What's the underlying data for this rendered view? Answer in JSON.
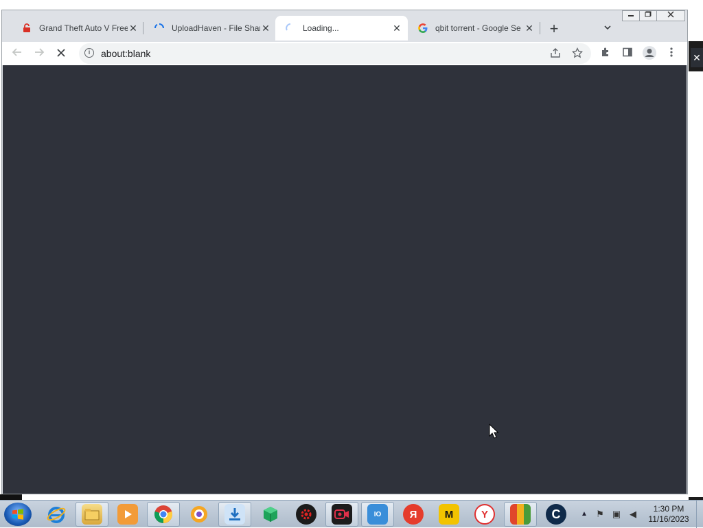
{
  "browser": {
    "tabs": [
      {
        "title": "Grand Theft Auto V Free",
        "favicon": "lock-red-icon",
        "active": false
      },
      {
        "title": "UploadHaven - File Shar",
        "favicon": "loading-spinner-icon",
        "active": false
      },
      {
        "title": "Loading...",
        "favicon": "loading-spinner-icon",
        "active": true
      },
      {
        "title": "qbit torrent - Google Se",
        "favicon": "google-icon",
        "active": false
      }
    ],
    "close_glyph": "✕",
    "new_tab_glyph": "+",
    "address": {
      "url": "about:blank"
    },
    "page_background": "#2f323b"
  },
  "desktop": {
    "close_glyph": "✕"
  },
  "taskbar": {
    "apps": [
      {
        "name": "internet-explorer-icon",
        "color": "#1e7fd8"
      },
      {
        "name": "file-explorer-icon",
        "color": "#e8c25a"
      },
      {
        "name": "media-player-icon",
        "color": "#f29b38"
      },
      {
        "name": "chrome-icon",
        "color": "#db4437"
      },
      {
        "name": "browser-circle-icon",
        "color": "#f5a623"
      },
      {
        "name": "downloader-icon",
        "color": "#3b89d6"
      },
      {
        "name": "cube-app-icon",
        "color": "#1ea35a"
      },
      {
        "name": "gear-red-icon",
        "color": "#c41c1c"
      },
      {
        "name": "screen-recorder-icon",
        "color": "#c0203a"
      },
      {
        "name": "iobit-icon",
        "color": "#3a8ed9"
      },
      {
        "name": "yandex-icon",
        "color": "#e53c2c"
      },
      {
        "name": "yellow-m-icon",
        "color": "#f2c300"
      },
      {
        "name": "yandex-browser-icon",
        "color": "#e03030"
      },
      {
        "name": "avg-icon",
        "color": "#4a9b3a"
      },
      {
        "name": "ccleaner-icon",
        "color": "#1b6fb8"
      }
    ],
    "clock": {
      "time": "1:30 PM",
      "date": "11/16/2023"
    }
  }
}
